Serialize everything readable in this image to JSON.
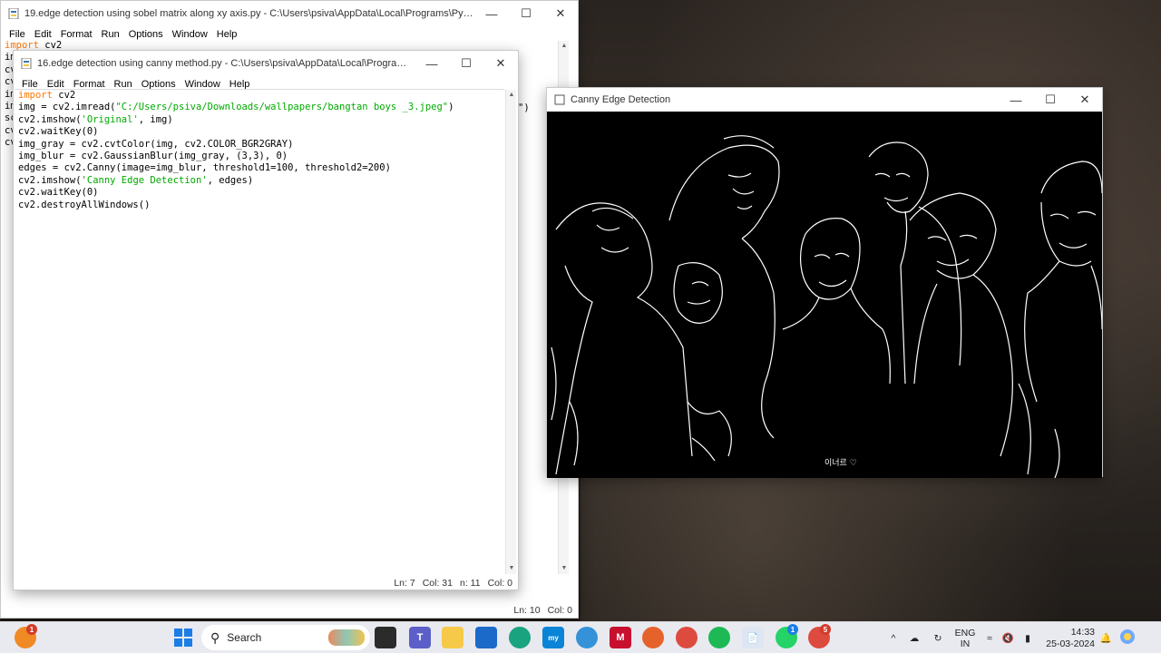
{
  "back_window": {
    "title": "19.edge detection using sobel matrix along xy axis.py - C:\\Users\\psiva\\AppData\\Local\\Programs\\Python\\Pytho...",
    "menu": [
      "File",
      "Edit",
      "Format",
      "Run",
      "Options",
      "Window",
      "Help"
    ],
    "first_line_kw": "import",
    "first_line_rest": " cv2",
    "line_prefixes": [
      "im",
      "cv",
      "cv",
      "im",
      "im",
      "sc",
      "cv",
      "cv"
    ],
    "stray_char": "\")",
    "status": {
      "ln": "Ln: 10",
      "col": "Col: 0"
    }
  },
  "front_window": {
    "title": "16.edge detection using canny method.py - C:\\Users\\psiva\\AppData\\Local\\Programs\\Pytho...",
    "menu": [
      "File",
      "Edit",
      "Format",
      "Run",
      "Options",
      "Window",
      "Help"
    ],
    "code": {
      "l1_kw": "import",
      "l1_rest": " cv2",
      "l2_a": "img = cv2.imread(",
      "l2_str": "\"C:/Users/psiva/Downloads/wallpapers/bangtan boys _3.jpeg\"",
      "l2_b": ")",
      "l3_a": "cv2.imshow(",
      "l3_str": "'Original'",
      "l3_b": ", img)",
      "l4": "cv2.waitKey(0)",
      "l5": "img_gray = cv2.cvtColor(img, cv2.COLOR_BGR2GRAY)",
      "l6": "img_blur = cv2.GaussianBlur(img_gray, (3,3), 0)",
      "l7": "edges = cv2.Canny(image=img_blur, threshold1=100, threshold2=200)",
      "l8_a": "cv2.imshow(",
      "l8_str": "'Canny Edge Detection'",
      "l8_b": ", edges)",
      "l9": "cv2.waitKey(0)",
      "l10": "cv2.destroyAllWindows()"
    },
    "status": {
      "ln": "Ln: 7",
      "col": "Col: 31",
      "extra": "n: 11",
      "col2": "Col: 0"
    }
  },
  "canny_window": {
    "title": "Canny Edge Detection",
    "watermark": "이너르 ♡"
  },
  "taskbar": {
    "search_placeholder": "Search",
    "notif_badge": "1",
    "whatsapp_badge": "1",
    "chrome2_badge": "5",
    "lang_top": "ENG",
    "lang_bottom": "IN",
    "time": "14:33",
    "date": "25-03-2024"
  },
  "colors": {
    "keyword": "#ff7700",
    "string": "#00aa00",
    "taskbar": "#e8eaf0"
  }
}
